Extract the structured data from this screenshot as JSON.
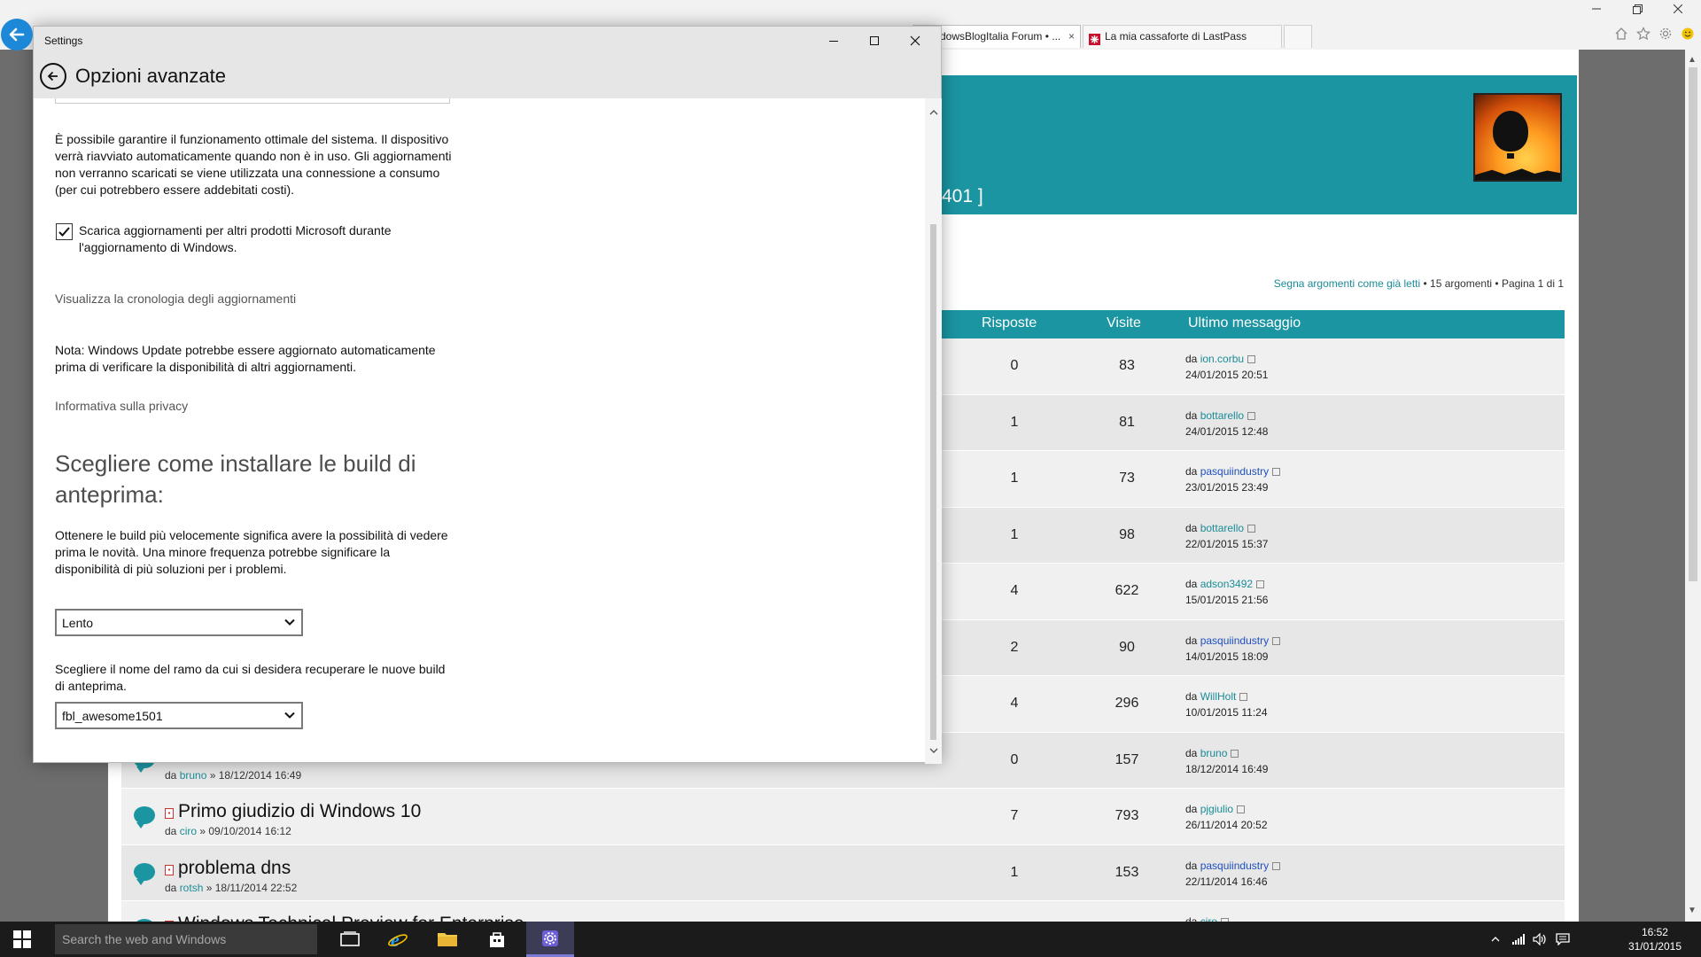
{
  "browser": {
    "tabs": [
      {
        "label": "dowsBlogItalia Forum • ..."
      },
      {
        "label": "La mia cassaforte di LastPass"
      }
    ],
    "tab_close": "×"
  },
  "forum": {
    "header_title": "401 ]",
    "meta_link": "Segna argomenti come già letti",
    "meta_rest": " • 15 argomenti • Pagina 1 di 1",
    "columns": {
      "risposte": "Risposte",
      "visite": "Visite",
      "ultimo": "Ultimo messaggio"
    },
    "rows": [
      {
        "title": "",
        "by_prefix": "",
        "by_user": "",
        "by_date": "",
        "risposte": "0",
        "visite": "83",
        "last_prefix": "da ",
        "last_user": "ion.corbu",
        "last_date": "24/01/2015 20:51",
        "alt": false
      },
      {
        "title": "",
        "by_prefix": "",
        "by_user": "",
        "by_date": "",
        "risposte": "1",
        "visite": "81",
        "last_prefix": "da ",
        "last_user": "bottarello",
        "last_date": "24/01/2015 12:48",
        "alt": false
      },
      {
        "title": "",
        "by_prefix": "",
        "by_user": "",
        "by_date": "",
        "risposte": "1",
        "visite": "73",
        "last_prefix": "da ",
        "last_user": "pasquiindustry",
        "last_date": "23/01/2015 23:49",
        "alt": true
      },
      {
        "title": "",
        "by_prefix": "",
        "by_user": "",
        "by_date": "",
        "risposte": "1",
        "visite": "98",
        "last_prefix": "da ",
        "last_user": "bottarello",
        "last_date": "22/01/2015 15:37",
        "alt": false
      },
      {
        "title": "",
        "by_prefix": "",
        "by_user": "",
        "by_date": "",
        "risposte": "4",
        "visite": "622",
        "last_prefix": "da ",
        "last_user": "adson3492",
        "last_date": "15/01/2015 21:56",
        "alt": false
      },
      {
        "title": "",
        "by_prefix": "",
        "by_user": "",
        "by_date": "",
        "risposte": "2",
        "visite": "90",
        "last_prefix": "da ",
        "last_user": "pasquiindustry",
        "last_date": "14/01/2015 18:09",
        "alt": true
      },
      {
        "title": "",
        "by_prefix": "",
        "by_user": "",
        "by_date": "",
        "risposte": "4",
        "visite": "296",
        "last_prefix": "da ",
        "last_user": "WillHolt",
        "last_date": "10/01/2015 11:24",
        "alt": false
      },
      {
        "title": "",
        "by_prefix": "da ",
        "by_user": "bruno",
        "by_date": " » 18/12/2014 16:49",
        "risposte": "0",
        "visite": "157",
        "last_prefix": "da ",
        "last_user": "bruno",
        "last_date": "18/12/2014 16:49",
        "alt": false
      },
      {
        "title": "Primo giudizio di Windows 10",
        "by_prefix": "da ",
        "by_user": "ciro",
        "by_date": " » 09/10/2014 16:12",
        "risposte": "7",
        "visite": "793",
        "last_prefix": "da ",
        "last_user": "pjgiulio",
        "last_date": "26/11/2014 20:52",
        "alt": false
      },
      {
        "title": "problema dns",
        "by_prefix": "da ",
        "by_user": "rotsh",
        "by_date": " » 18/11/2014 22:52",
        "risposte": "1",
        "visite": "153",
        "last_prefix": "da ",
        "last_user": "pasquiindustry",
        "last_date": "22/11/2014 16:46",
        "alt": true
      },
      {
        "title": "Windows Technical Preview for Enterprise",
        "by_prefix": "",
        "by_user": "",
        "by_date": "",
        "risposte": "",
        "visite": "",
        "last_prefix": "da ",
        "last_user": "ciro",
        "last_date": "",
        "alt": false
      }
    ]
  },
  "settings": {
    "window_title": "Settings",
    "heading": "Opzioni avanzate",
    "para_1": "È possibile garantire il funzionamento ottimale del sistema. Il dispositivo verrà riavviato automaticamente quando non è in uso. Gli aggiornamenti non verranno scaricati se viene utilizzata una connessione a consumo (per cui potrebbero essere addebitati costi).",
    "checkbox_label": "Scarica aggiornamenti per altri prodotti Microsoft durante l'aggiornamento di Windows.",
    "checkbox_checked": true,
    "link_cronologia": "Visualizza la cronologia degli aggiornamenti",
    "para_nota": "Nota: Windows Update potrebbe essere aggiornato automaticamente prima di verificare la disponibilità di altri aggiornamenti.",
    "link_privacy": "Informativa sulla privacy",
    "heading_2": "Scegliere come installare le build di anteprima:",
    "para_build": "Ottenere le build più velocemente significa avere la possibilità di vedere prima le novità. Una minore frequenza potrebbe significare la disponibilità di più soluzioni per i problemi.",
    "select_speed": "Lento",
    "para_ramo": "Scegliere il nome del ramo da cui si desidera recuperare le nuove build di anteprima.",
    "select_branch": "fbl_awesome1501"
  },
  "taskbar": {
    "search_placeholder": "Search the web and Windows",
    "time": "16:52",
    "date": "31/01/2015"
  },
  "colors": {
    "forum_accent": "#1a95a1",
    "browser_back": "#1e88d8",
    "taskbar": "#1b1b1b"
  }
}
